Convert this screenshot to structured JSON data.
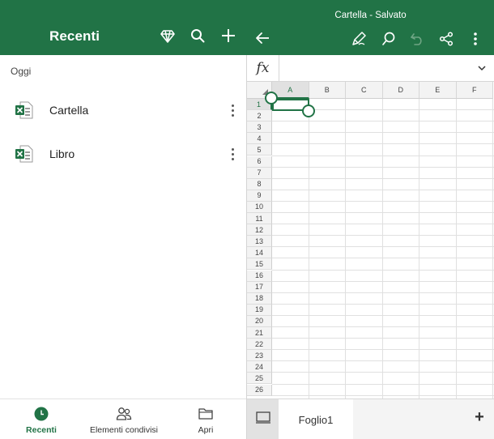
{
  "left_panel": {
    "title": "Recenti",
    "section_label": "Oggi",
    "header_icons": [
      "diamond-icon",
      "search-icon",
      "plus-icon"
    ],
    "files": [
      {
        "name": "Cartella",
        "icon": "excel-file-icon"
      },
      {
        "name": "Libro",
        "icon": "excel-file-icon"
      }
    ],
    "bottom_nav": [
      {
        "label": "Recenti",
        "icon": "clock-icon",
        "active": true
      },
      {
        "label": "Elementi condivisi",
        "icon": "people-icon",
        "active": false
      },
      {
        "label": "Apri",
        "icon": "folder-icon",
        "active": false
      }
    ]
  },
  "workbook": {
    "title": "Cartella - Salvato",
    "toolbar_icons": [
      "back-arrow-icon",
      "pen-icon",
      "search-icon",
      "undo-icon",
      "share-icon",
      "more-vertical-icon"
    ],
    "formula": {
      "label": "fx",
      "value": ""
    },
    "columns": [
      "A",
      "B",
      "C",
      "D",
      "E",
      "F"
    ],
    "rows": [
      "1",
      "2",
      "3",
      "4",
      "5",
      "6",
      "7",
      "8",
      "9",
      "10",
      "11",
      "12",
      "13",
      "14",
      "15",
      "16",
      "17",
      "18",
      "19",
      "20",
      "21",
      "22",
      "23",
      "24",
      "25",
      "26"
    ],
    "selected_cell": "A1",
    "sheets": [
      {
        "name": "Foglio1",
        "active": true
      }
    ],
    "add_sheet_label": "+"
  },
  "colors": {
    "brand": "#217346",
    "header_bg": "#f3f3f3",
    "grid_line": "#e0e0e0"
  }
}
